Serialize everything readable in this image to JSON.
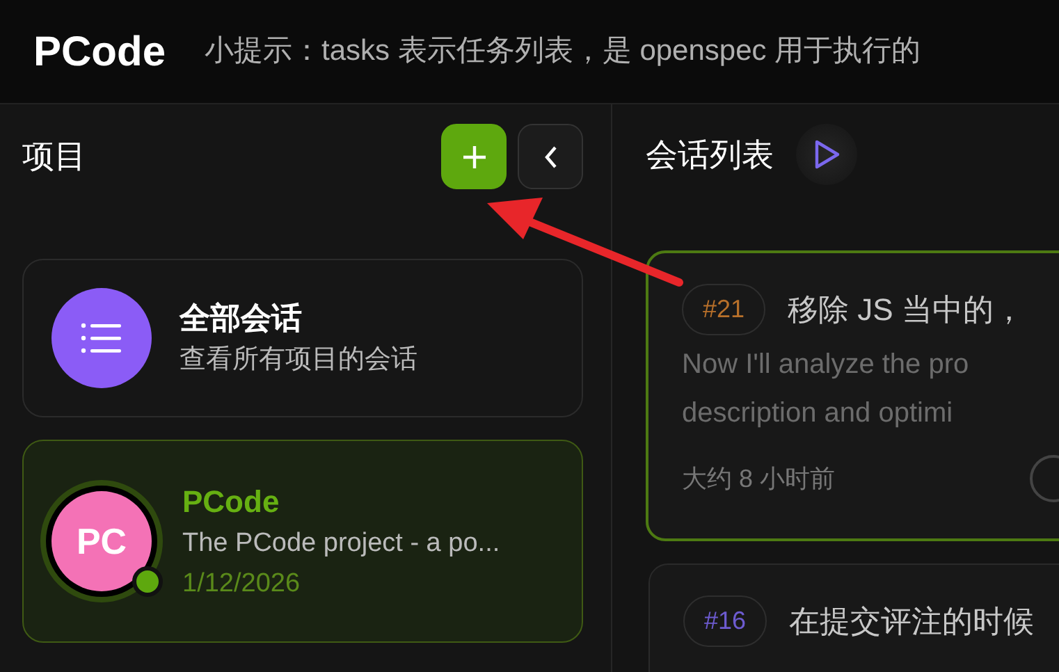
{
  "header": {
    "logo": "PCode",
    "tip": "小提示：tasks 表示任务列表，是 openspec 用于执行的"
  },
  "projects_panel": {
    "title": "项目"
  },
  "projects": [
    {
      "kind": "all",
      "name": "全部会话",
      "description": "查看所有项目的会话",
      "selected": false,
      "color": "#8b5cf6"
    },
    {
      "kind": "project",
      "initials": "PC",
      "name": "PCode",
      "description": "The PCode project - a po...",
      "date": "1/12/2026",
      "selected": true,
      "online": true,
      "color": "#f472b6"
    }
  ],
  "sessions_panel": {
    "title": "会话列表"
  },
  "sessions": [
    {
      "number": "#21",
      "title": "移除 JS 当中的，",
      "preview_lines": [
        "Now I'll analyze the pro",
        "description and optimi"
      ],
      "time": "大约 8 小时前",
      "selected": true,
      "color": "#b8702a"
    },
    {
      "number": "#16",
      "title": "在提交评注的时候",
      "selected": false,
      "color": "#6d5bd0"
    }
  ]
}
